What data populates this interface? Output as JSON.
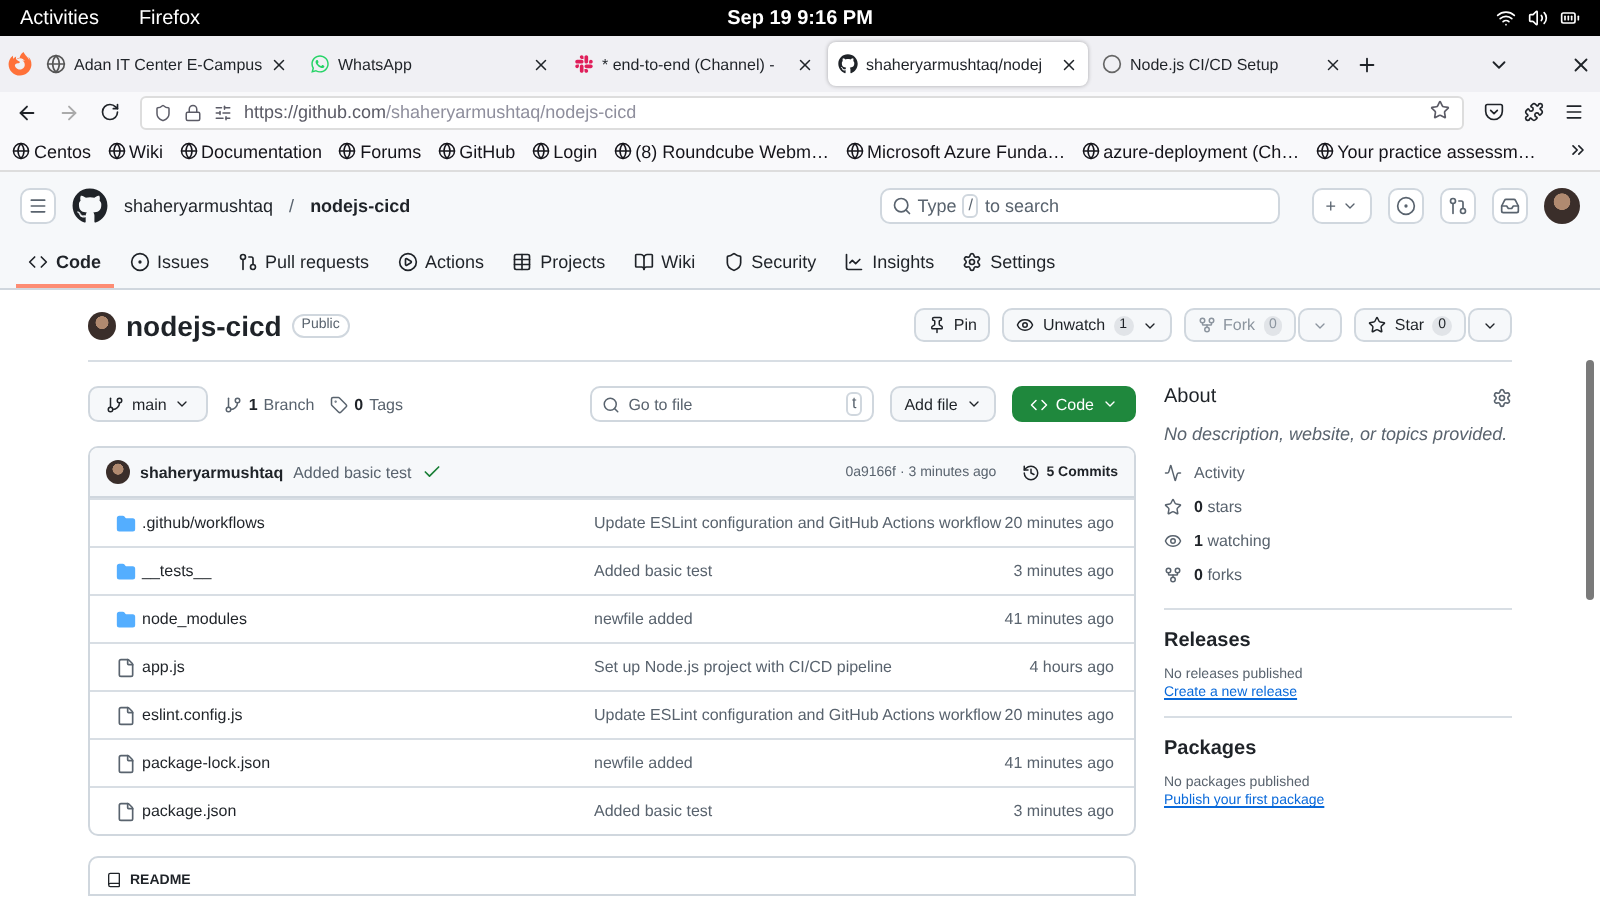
{
  "system_bar": {
    "activities": "Activities",
    "app": "Firefox",
    "clock": "Sep 19  9:16 PM"
  },
  "browser_tabs": [
    {
      "title": "Adan IT Center E-Campus",
      "selected": false
    },
    {
      "title": "WhatsApp",
      "selected": false
    },
    {
      "title": "* end-to-end (Channel) -",
      "selected": false
    },
    {
      "title": "shaheryarmushtaq/nodej",
      "selected": true
    },
    {
      "title": "Node.js CI/CD Setup",
      "selected": false
    }
  ],
  "address_bar": {
    "url_host": "https://github.com",
    "url_path": "/shaheryarmushtaq/nodejs-cicd"
  },
  "bookmarks": [
    "Centos",
    "Wiki",
    "Documentation",
    "Forums",
    "GitHub",
    "Login",
    "(8) Roundcube Webm…",
    "Microsoft Azure Funda…",
    "azure-deployment (Ch…",
    "Your practice assessm…"
  ],
  "header": {
    "owner": "shaheryarmushtaq",
    "separator": "/",
    "repo": "nodejs-cicd",
    "search": {
      "before": "Type",
      "key": "/",
      "after": "to search"
    },
    "new_menu": "+"
  },
  "repo_nav": [
    {
      "label": "Code",
      "selected": true
    },
    {
      "label": "Issues",
      "selected": false
    },
    {
      "label": "Pull requests",
      "selected": false
    },
    {
      "label": "Actions",
      "selected": false
    },
    {
      "label": "Projects",
      "selected": false
    },
    {
      "label": "Wiki",
      "selected": false
    },
    {
      "label": "Security",
      "selected": false
    },
    {
      "label": "Insights",
      "selected": false
    },
    {
      "label": "Settings",
      "selected": false
    }
  ],
  "repo": {
    "name": "nodejs-cicd",
    "visibility": "Public",
    "actions": [
      {
        "kind": "pin",
        "label": "Pin",
        "disabled": false
      },
      {
        "kind": "watch",
        "label": "Unwatch",
        "count": "1",
        "disabled": false
      },
      {
        "kind": "fork",
        "label": "Fork",
        "count": "0",
        "disabled": true
      },
      {
        "kind": "star",
        "label": "Star",
        "count": "0",
        "disabled": false
      }
    ]
  },
  "branch_bar": {
    "branch": "main",
    "branches_count": "1",
    "branches_label": "Branch",
    "tags_count": "0",
    "tags_label": "Tags",
    "file_search": {
      "placeholder": "Go to file",
      "key": "t"
    },
    "add_file": "Add file",
    "code": "Code"
  },
  "latest_commit": {
    "author": "shaheryarmushtaq",
    "message": "Added basic test",
    "passed": true,
    "hash_time": "0a9166f · 3 minutes ago",
    "commits": "5 Commits"
  },
  "files": [
    {
      "kind": "folder",
      "name": ".github/workflows",
      "message": "Update ESLint configuration and GitHub Actions workflow",
      "time": "20 minutes ago"
    },
    {
      "kind": "folder",
      "name": "__tests__",
      "message": "Added basic test",
      "time": "3 minutes ago"
    },
    {
      "kind": "folder",
      "name": "node_modules",
      "message": "newfile added",
      "time": "41 minutes ago"
    },
    {
      "kind": "file",
      "name": "app.js",
      "message": "Set up Node.js project with CI/CD pipeline",
      "time": "4 hours ago"
    },
    {
      "kind": "file",
      "name": "eslint.config.js",
      "message": "Update ESLint configuration and GitHub Actions workflow",
      "time": "20 minutes ago"
    },
    {
      "kind": "file",
      "name": "package-lock.json",
      "message": "newfile added",
      "time": "41 minutes ago"
    },
    {
      "kind": "file",
      "name": "package.json",
      "message": "Added basic test",
      "time": "3 minutes ago"
    }
  ],
  "readme": {
    "title": "README"
  },
  "about": {
    "title": "About",
    "description": "No description, website, or topics provided.",
    "stats": [
      {
        "kind": "activity",
        "label": "Activity"
      },
      {
        "kind": "stars",
        "value": "0",
        "label": "stars"
      },
      {
        "kind": "watching",
        "value": "1",
        "label": "watching"
      },
      {
        "kind": "forks",
        "value": "0",
        "label": "forks"
      }
    ]
  },
  "releases": {
    "title": "Releases",
    "text": "No releases published",
    "link": "Create a new release"
  },
  "packages": {
    "title": "Packages",
    "text": "No packages published",
    "link": "Publish your first package"
  }
}
